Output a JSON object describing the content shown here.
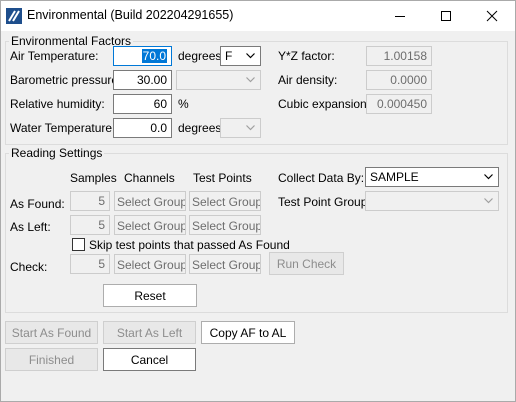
{
  "window": {
    "title": "Environmental (Build 202204291655)"
  },
  "env": {
    "group_title": "Environmental Factors",
    "air_temp_label": "Air Temperature:",
    "air_temp_value": "70.0",
    "degrees_label": "degrees",
    "air_temp_unit": "F",
    "baro_label": "Barometric pressure:",
    "baro_value": "30.00",
    "baro_unit": "",
    "humidity_label": "Relative humidity:",
    "humidity_value": "60",
    "percent_label": "%",
    "water_temp_label": "Water Temperature:",
    "water_temp_value": "0.0",
    "water_unit": "",
    "yz_label": "Y*Z factor:",
    "yz_value": "1.00158",
    "density_label": "Air density:",
    "density_value": "0.0000",
    "cubic_label": "Cubic expansion:",
    "cubic_value": "0.000450"
  },
  "reading": {
    "group_title": "Reading Settings",
    "hdr_samples": "Samples",
    "hdr_channels": "Channels",
    "hdr_test_points": "Test Points",
    "as_found_label": "As Found:",
    "as_left_label": "As Left:",
    "check_label": "Check:",
    "as_found_samples": "5",
    "as_left_samples": "5",
    "check_samples": "5",
    "select_group": "Select Group",
    "collect_label": "Collect Data By:",
    "collect_value": "SAMPLE",
    "tp_group_label": "Test Point Group:",
    "tp_group_value": "",
    "skip_label": "Skip test points that passed As Found",
    "run_check": "Run Check",
    "reset": "Reset"
  },
  "buttons": {
    "start_as_found": "Start As Found",
    "start_as_left": "Start As Left",
    "copy_af_al": "Copy AF to AL",
    "finished": "Finished",
    "cancel": "Cancel"
  }
}
